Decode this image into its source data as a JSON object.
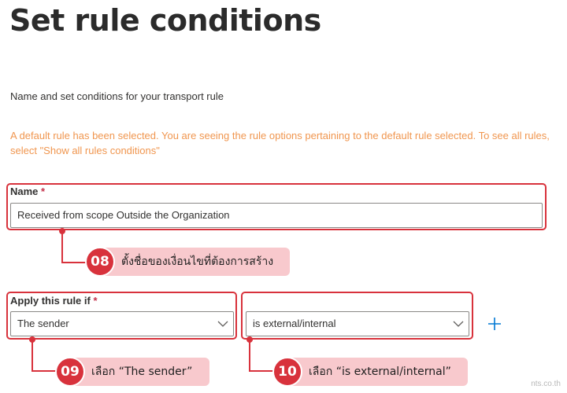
{
  "page": {
    "title": "Set rule conditions",
    "subtitle": "Name and set conditions for your transport rule",
    "warning": "A default rule has been selected. You are seeing the rule options pertaining to the default rule selected. To see all rules, select \"Show all rules conditions\""
  },
  "name_field": {
    "label": "Name",
    "required_mark": "*",
    "value": "Received from scope Outside the Organization"
  },
  "apply_rule": {
    "label": "Apply this rule if",
    "required_mark": "*",
    "condition_value": "The sender",
    "operator_value": "is external/internal"
  },
  "annotations": [
    {
      "number": "08",
      "text": "ตั้งชื่อของเงื่อนไขที่ต้องการสร้าง"
    },
    {
      "number": "09",
      "text": "เลือก “The sender”"
    },
    {
      "number": "10",
      "text": "เลือก “is external/internal”"
    }
  ],
  "watermark": "nts.co.th",
  "colors": {
    "accent": "#0078d4",
    "warning": "#f0964f",
    "annotation_red": "#d8323c",
    "annotation_fill": "#f8c9cd",
    "required": "#c4314b"
  },
  "icons": {
    "dropdown": "chevron-down-icon",
    "add": "plus-icon"
  }
}
